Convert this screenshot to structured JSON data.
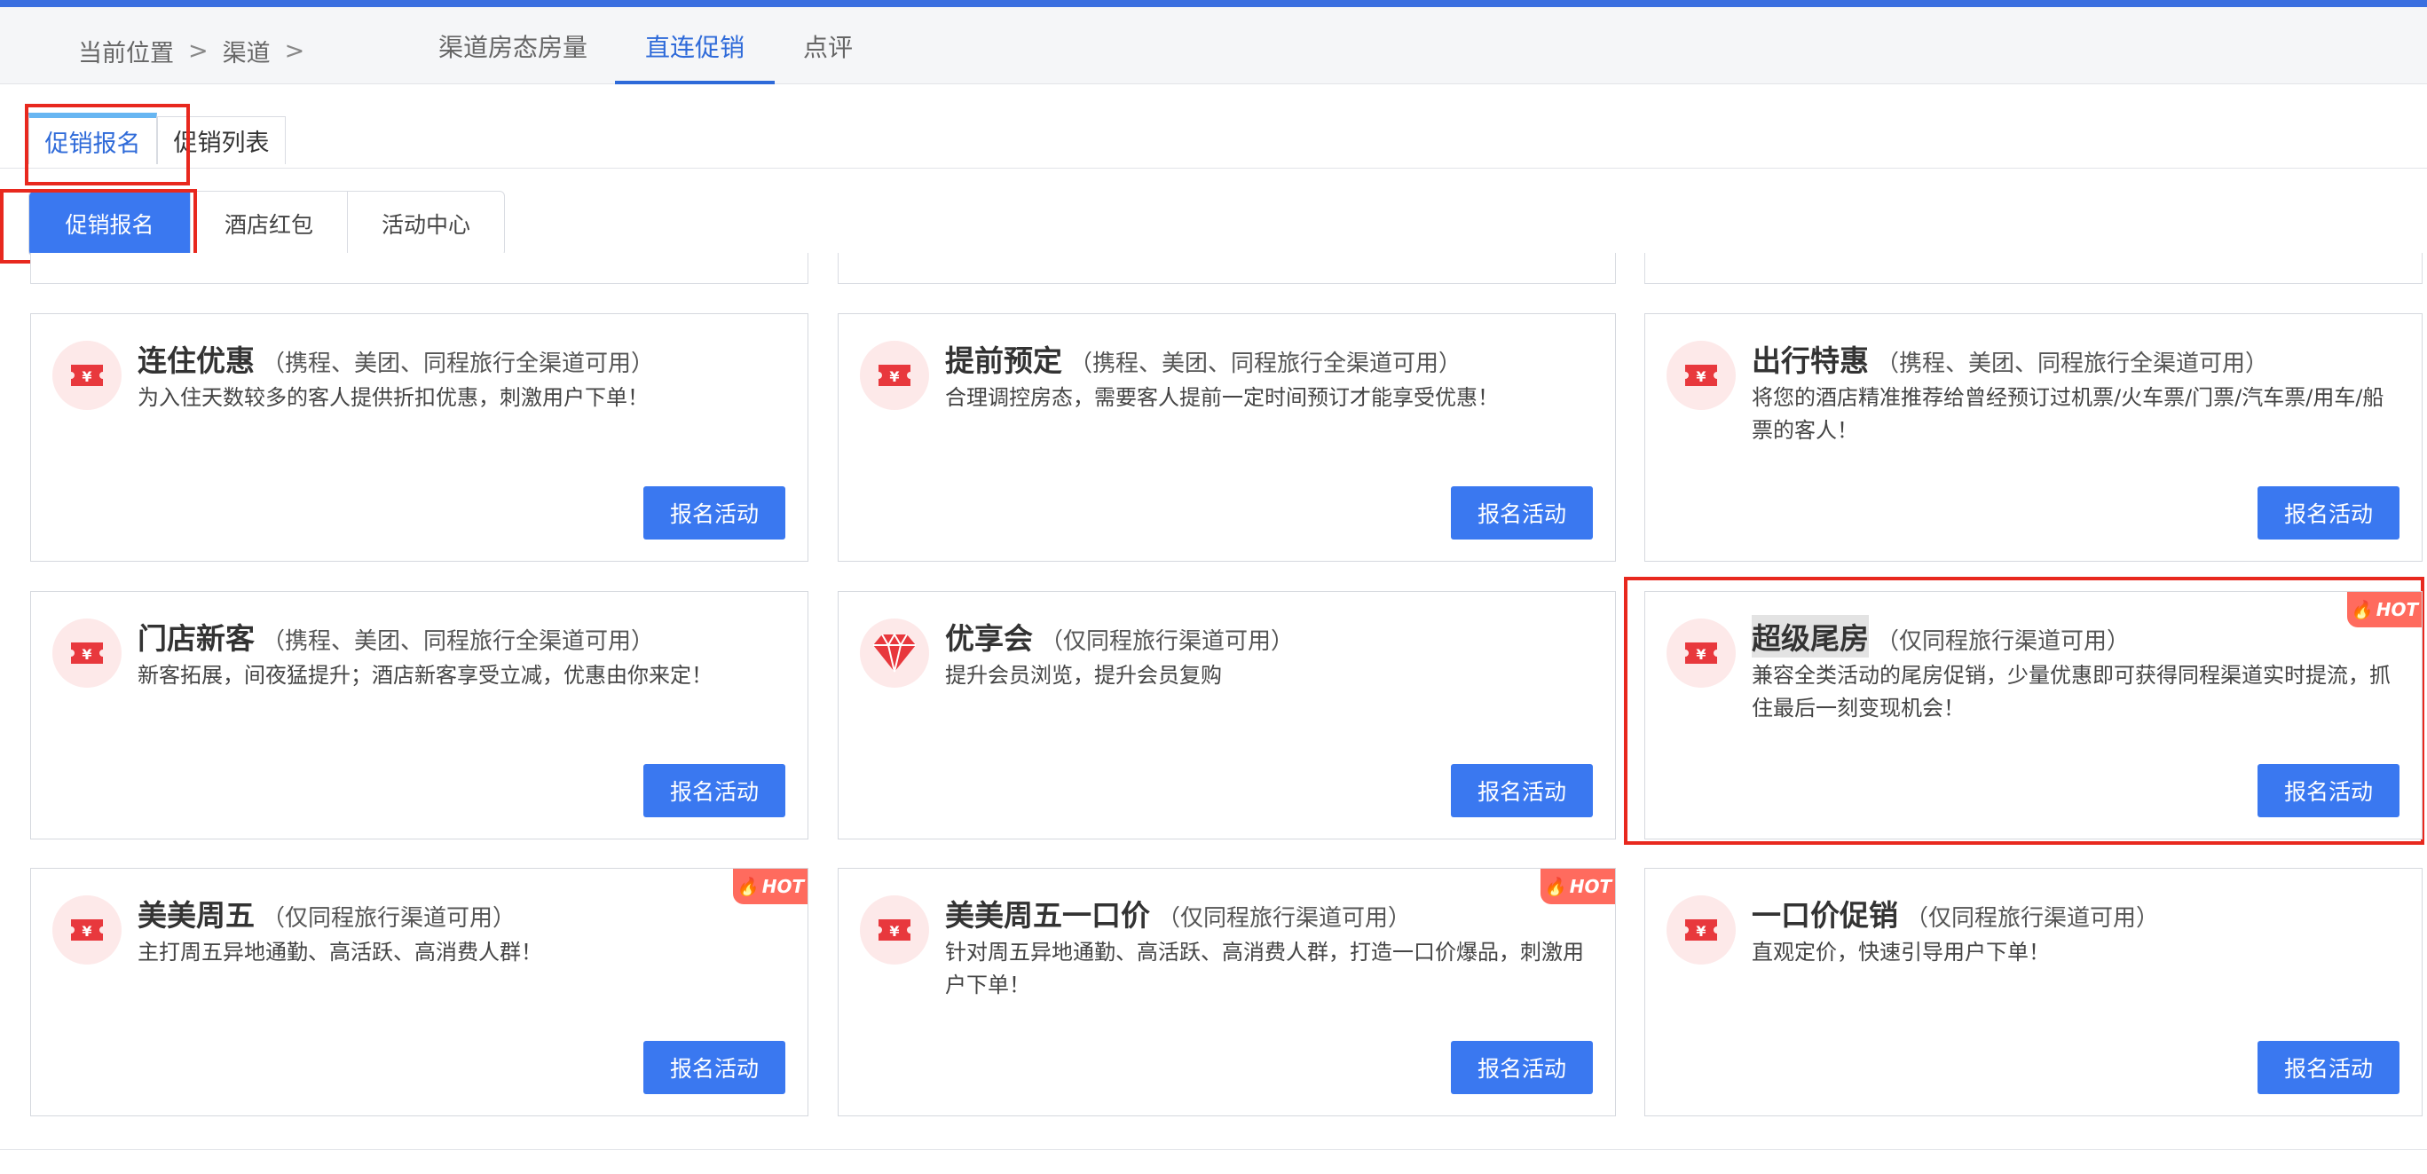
{
  "breadcrumb": {
    "current_position": "当前位置",
    "separator": ">",
    "channel": "渠道"
  },
  "channel_tabs": [
    {
      "label": "渠道房态房量",
      "active": false
    },
    {
      "label": "直连促销",
      "active": true
    },
    {
      "label": "点评",
      "active": false
    }
  ],
  "sub_tabs": [
    {
      "label": "促销报名",
      "active": true
    },
    {
      "label": "促销列表",
      "active": false
    }
  ],
  "segments": [
    {
      "label": "促销报名",
      "active": true
    },
    {
      "label": "酒店红包",
      "active": false
    },
    {
      "label": "活动中心",
      "active": false
    }
  ],
  "cards": [
    {
      "title": "连住优惠",
      "scope": "（携程、美团、同程旅行全渠道可用）",
      "desc": "为入住天数较多的客人提供折扣优惠，刺激用户下单！",
      "icon": "ticket-yuan-icon",
      "hot": false,
      "button": "报名活动"
    },
    {
      "title": "提前预定",
      "scope": "（携程、美团、同程旅行全渠道可用）",
      "desc": "合理调控房态，需要客人提前一定时间预订才能享受优惠！",
      "icon": "ticket-yuan-icon",
      "hot": false,
      "button": "报名活动"
    },
    {
      "title": "出行特惠",
      "scope": "（携程、美团、同程旅行全渠道可用）",
      "desc": "将您的酒店精准推荐给曾经预订过机票/火车票/门票/汽车票/用车/船票的客人！",
      "icon": "ticket-yuan-icon",
      "hot": false,
      "button": "报名活动"
    },
    {
      "title": "门店新客",
      "scope": "（携程、美团、同程旅行全渠道可用）",
      "desc": "新客拓展，间夜猛提升；酒店新客享受立减，优惠由你来定！",
      "icon": "ticket-yuan-icon",
      "hot": false,
      "button": "报名活动"
    },
    {
      "title": "优享会",
      "scope": "（仅同程旅行渠道可用）",
      "desc": "提升会员浏览，提升会员复购",
      "icon": "diamond-icon",
      "hot": false,
      "button": "报名活动"
    },
    {
      "title": "超级尾房",
      "scope": "（仅同程旅行渠道可用）",
      "desc": "兼容全类活动的尾房促销，少量优惠即可获得同程渠道实时提流，抓住最后一刻变现机会！",
      "icon": "ticket-yuan-icon",
      "hot": true,
      "button": "报名活动"
    },
    {
      "title": "美美周五",
      "scope": "（仅同程旅行渠道可用）",
      "desc": "主打周五异地通勤、高活跃、高消费人群！",
      "icon": "ticket-yuan-icon",
      "hot": true,
      "button": "报名活动"
    },
    {
      "title": "美美周五一口价",
      "scope": "（仅同程旅行渠道可用）",
      "desc": "针对周五异地通勤、高活跃、高消费人群，打造一口价爆品，刺激用户下单！",
      "icon": "ticket-yuan-icon",
      "hot": true,
      "button": "报名活动"
    },
    {
      "title": "一口价促销",
      "scope": "（仅同程旅行渠道可用）",
      "desc": "直观定价，快速引导用户下单！",
      "icon": "ticket-yuan-icon",
      "hot": false,
      "button": "报名活动"
    }
  ],
  "hot_badge": "HOT",
  "colors": {
    "accent": "#3a78f0",
    "annotation_red": "#e8281e",
    "hot_badge": "#ff6b5e",
    "icon_red": "#e8383d"
  }
}
